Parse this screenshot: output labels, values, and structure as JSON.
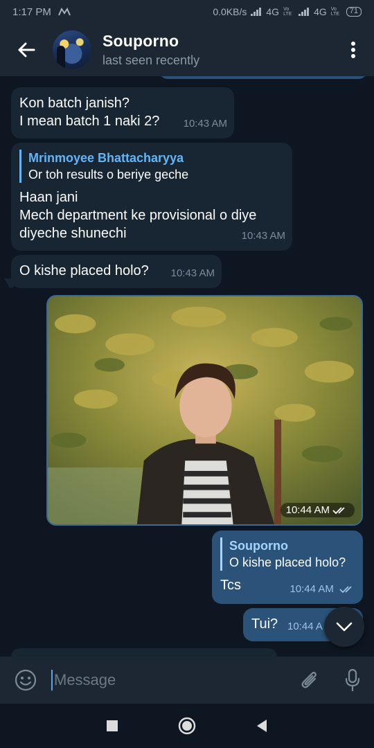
{
  "status_bar": {
    "time": "1:17 PM",
    "carrier_icon": "m-logo-icon",
    "network_speed": "0.0KB/s",
    "network1": "4G",
    "network2": "4G",
    "volte1": "Vo LTE",
    "volte2": "Vo LTE",
    "battery": "71"
  },
  "header": {
    "back_icon": "arrow-left-icon",
    "contact_name": "Souporno",
    "contact_status": "last seen recently",
    "more_icon": "more-vertical-icon"
  },
  "messages": [
    {
      "direction": "in",
      "lines": [
        "Kon batch janish?",
        "I mean batch 1 naki 2?"
      ],
      "time": "10:43 AM"
    },
    {
      "direction": "in",
      "reply_name": "Mrinmoyee Bhattacharyya",
      "reply_text": "Or toh results o beriye geche",
      "lines": [
        "Haan jani",
        "Mech department ke provisional o diye",
        "diyeche shunechi"
      ],
      "time": "10:43 AM"
    },
    {
      "direction": "in",
      "lines": [
        "O kishe placed holo?"
      ],
      "time": "10:43 AM"
    },
    {
      "direction": "out",
      "type": "photo",
      "time": "10:44 AM"
    },
    {
      "direction": "out",
      "reply_name": "Souporno",
      "reply_text": "O kishe placed holo?",
      "lines": [
        "Tcs"
      ],
      "time": "10:44 AM"
    },
    {
      "direction": "out",
      "lines": [
        "Tui?"
      ],
      "time": "10:44 A"
    }
  ],
  "input": {
    "placeholder": "Message",
    "emoji_icon": "emoji-icon",
    "attach_icon": "paperclip-icon",
    "mic_icon": "microphone-icon"
  },
  "nav": {
    "recents_icon": "square-icon",
    "home_icon": "circle-icon",
    "back_icon": "triangle-back-icon"
  },
  "colors": {
    "background": "#0e1621",
    "header": "#1c2733",
    "incoming_bubble": "#182533",
    "outgoing_bubble": "#2b5278",
    "accent": "#64b5f6"
  }
}
